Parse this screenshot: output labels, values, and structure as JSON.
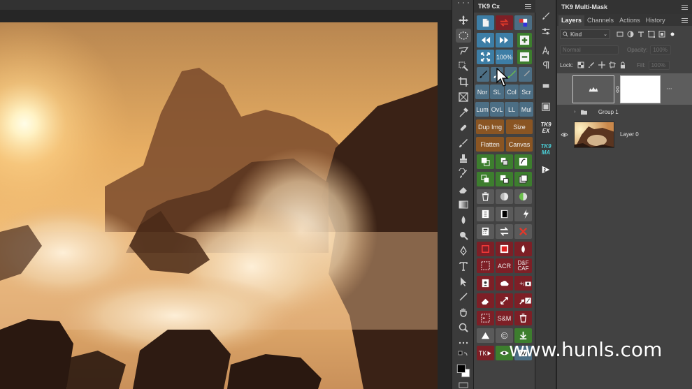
{
  "tk9_panel": {
    "title": "TK9 Cx",
    "zoom_label": "100%",
    "blend_buttons": [
      "Nor",
      "SL",
      "Col",
      "Scr",
      "Lum",
      "OvL",
      "LL",
      "Mul"
    ],
    "dup_img_label": "Dup Img",
    "size_label": "Size",
    "flatten_label": "Flatten",
    "canvas_label": "Canvas",
    "acr_label": "ACR",
    "dfcaf_label": "D&F CAF",
    "plus_minus_label": "+/-",
    "sm_label": "S&M",
    "copyright_label": "©",
    "tk_label": "TK"
  },
  "side_column": {
    "tk9_ex": "TK9 EX",
    "tk9_ma": "TK9 MA"
  },
  "multi_mask_panel": {
    "title": "TK9 Multi-Mask"
  },
  "layers_panel": {
    "tabs": [
      "Layers",
      "Channels",
      "Actions",
      "History"
    ],
    "active_tab": "Layers",
    "kind_filter": "Kind",
    "blend_mode": "Normal",
    "opacity_label": "Opacity:",
    "opacity_value": "100%",
    "lock_label": "Lock:",
    "fill_label": "Fill:",
    "fill_value": "100%",
    "layers": [
      {
        "name": "",
        "type": "mask-layer",
        "selected": true
      },
      {
        "name": "Group 1",
        "type": "group",
        "selected": false
      },
      {
        "name": "Layer 0",
        "type": "image",
        "selected": false
      }
    ]
  },
  "watermark": "www.hunls.com",
  "colors": {
    "app_bg": "#262626",
    "panel_bg": "#424242",
    "btn_blue": "#3d7ea6",
    "btn_green": "#3d7e2e",
    "btn_maroon": "#7d1f26",
    "btn_slate": "#4c6e84",
    "btn_brown": "#8a5523"
  }
}
